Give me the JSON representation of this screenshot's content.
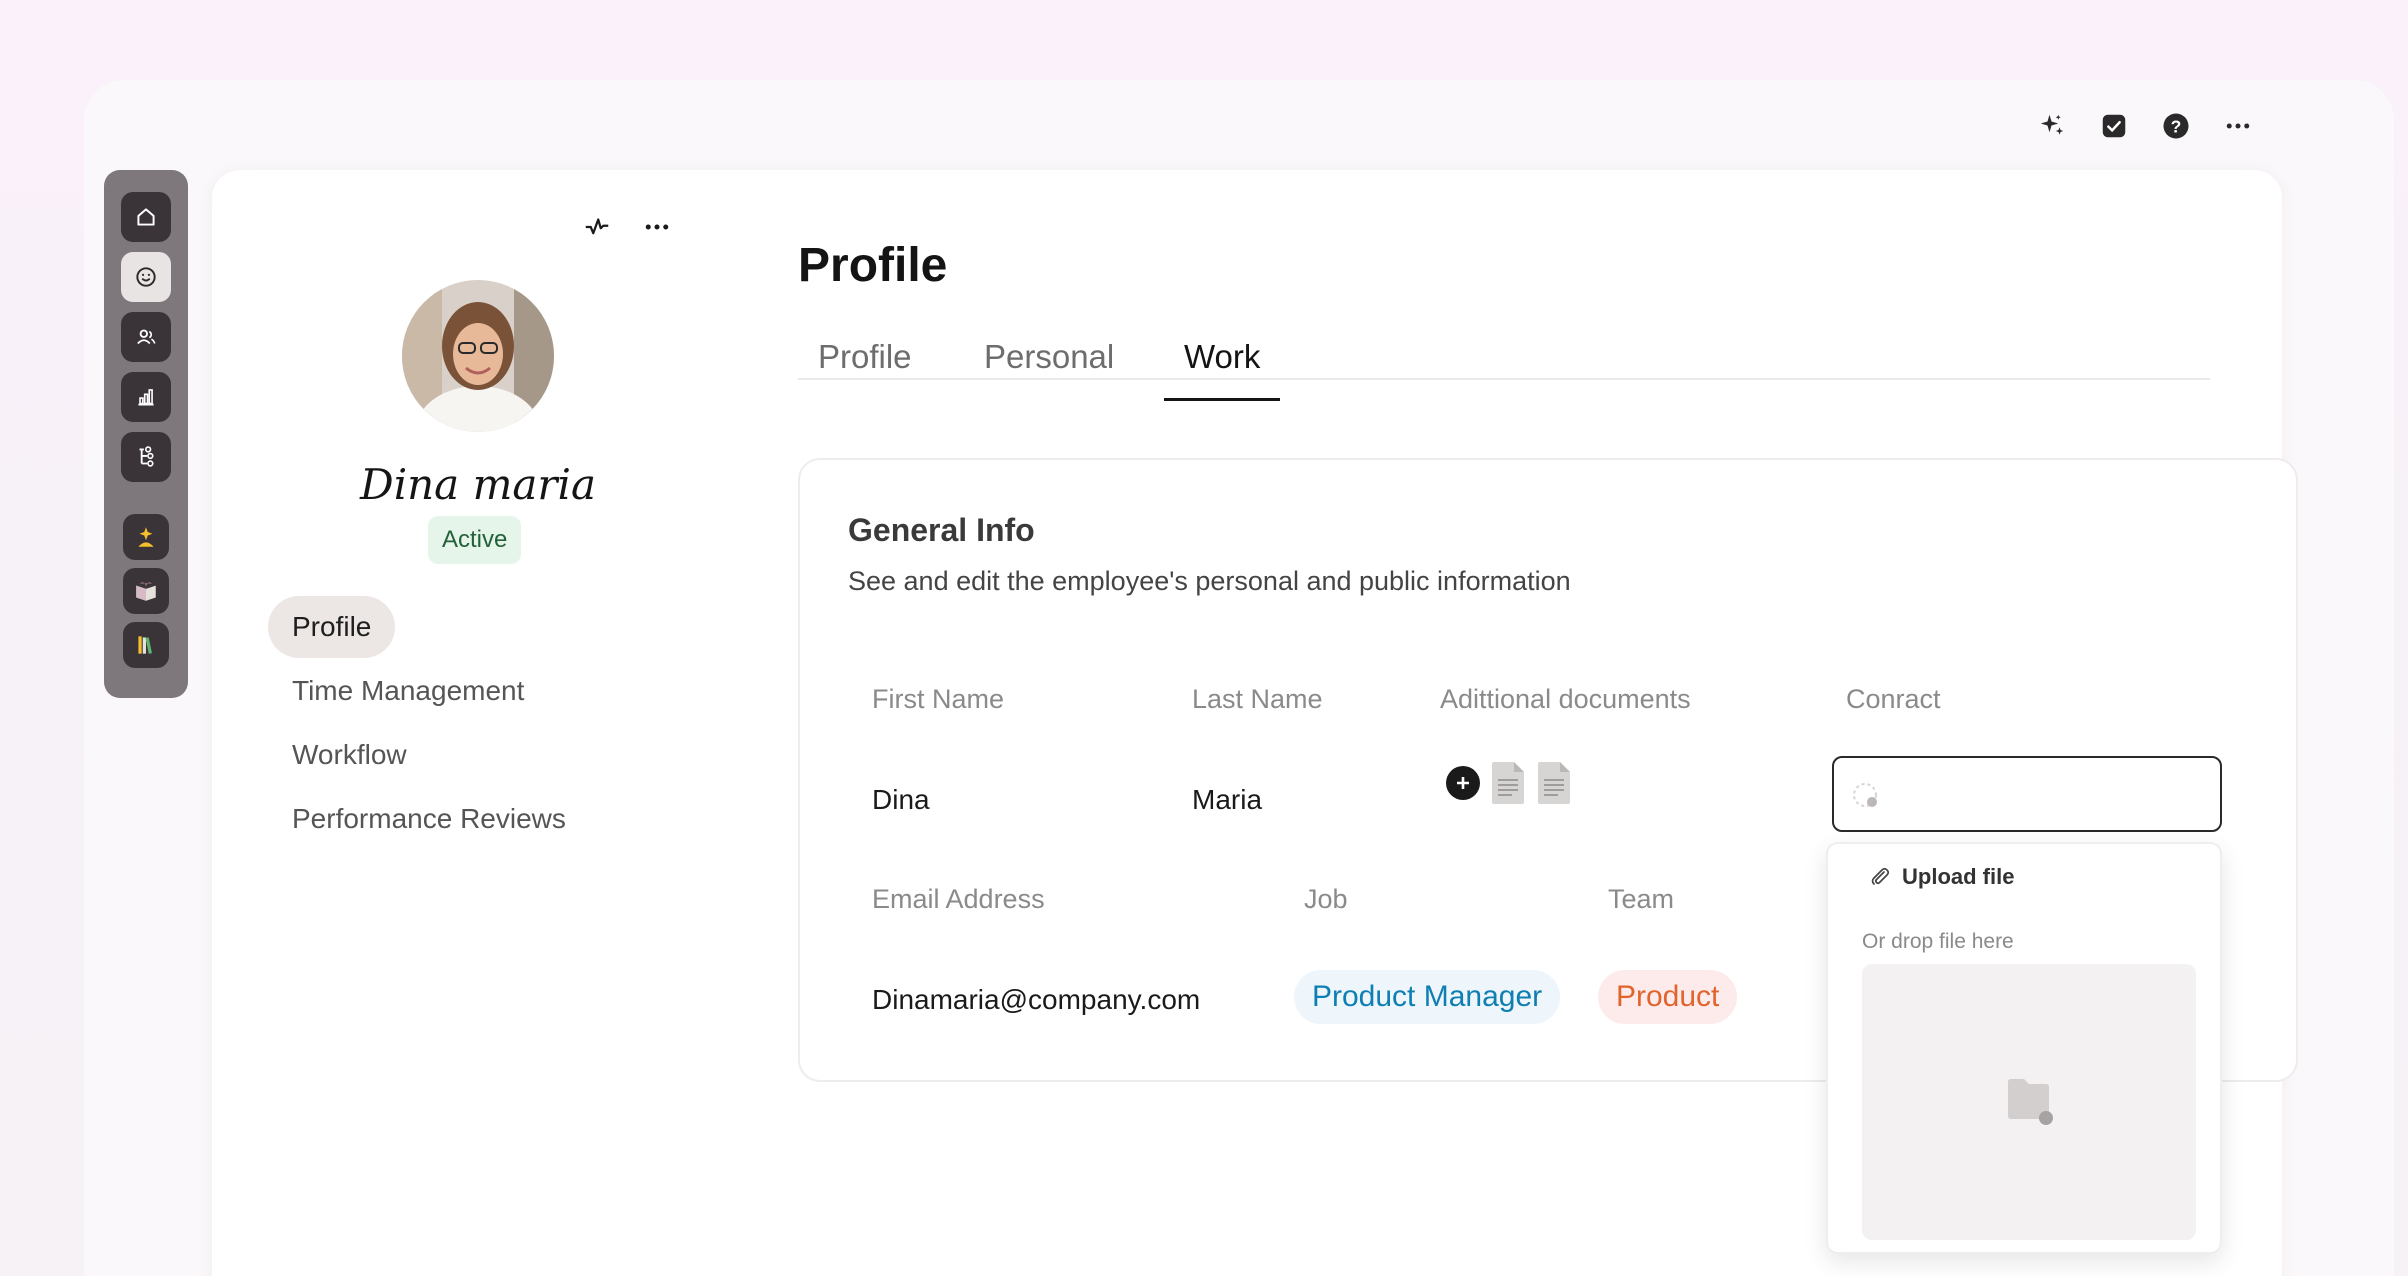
{
  "top_toolbar": {
    "icons": [
      "sparkles-icon",
      "check-square-icon",
      "help-icon",
      "more-icon"
    ]
  },
  "rail": {
    "icons": [
      "home-icon",
      "smile-icon",
      "people-icon",
      "chart-icon",
      "hierarchy-icon",
      "person-star-icon",
      "book-icon",
      "library-icon"
    ]
  },
  "profile": {
    "name": "Dina maria",
    "status": "Active",
    "status_color": "#24613a"
  },
  "side_nav": {
    "items": [
      {
        "label": "Profile"
      },
      {
        "label": "Time Management"
      },
      {
        "label": "Workflow"
      },
      {
        "label": "Performance Reviews"
      }
    ]
  },
  "main": {
    "title": "Profile",
    "tabs": [
      {
        "label": "Profile"
      },
      {
        "label": "Personal"
      },
      {
        "label": "Work"
      }
    ],
    "general": {
      "title": "General Info",
      "description": "See and edit the employee's personal and public information",
      "first_name_label": "First Name",
      "last_name_label": "Last Name",
      "docs_label": "Adittional documents",
      "contract_label": "Conract",
      "first_name": "Dina",
      "last_name": "Maria",
      "email_label": "Email Address",
      "job_label": "Job",
      "team_label": "Team",
      "email": "Dinamaria@company.com",
      "job": "Product Manager",
      "team": "Product",
      "job_color": "#0d7fb2",
      "team_color": "#e2642d"
    }
  },
  "upload_dropdown": {
    "upload_label": "Upload file",
    "drop_hint": "Or drop file here"
  }
}
